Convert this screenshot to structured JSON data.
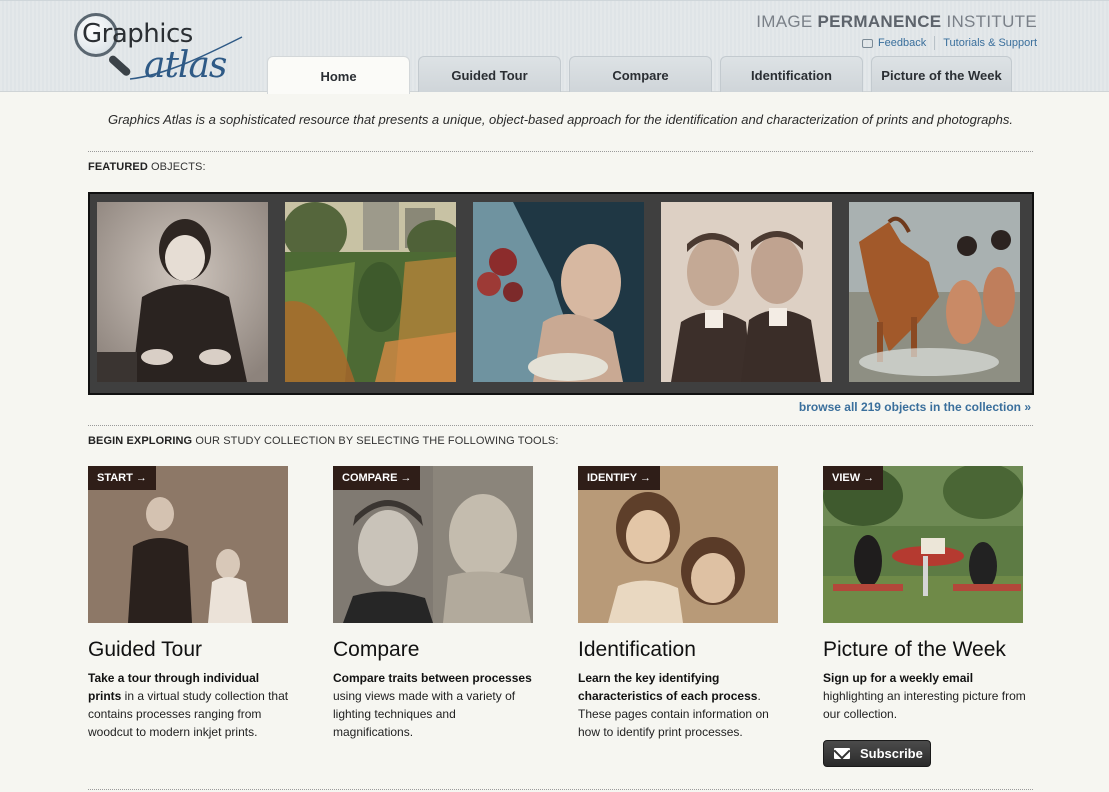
{
  "logo": {
    "word1": "Graphics",
    "word2": "atlas"
  },
  "institute": {
    "part1": "IMAGE ",
    "part2": "PERMANENCE",
    "part3": " INSTITUTE"
  },
  "util_links": {
    "feedback": "Feedback",
    "tutorials": "Tutorials & Support"
  },
  "tabs": [
    {
      "label": "Home",
      "active": true
    },
    {
      "label": "Guided Tour"
    },
    {
      "label": "Compare"
    },
    {
      "label": "Identification"
    },
    {
      "label": "Picture of the Week"
    }
  ],
  "intro": "Graphics Atlas is a sophisticated resource that presents a unique, object-based approach for the identification and characterization of prints and photographs.",
  "featured": {
    "label_bold": "FEATURED",
    "label_rest": " OBJECTS:"
  },
  "browse_link": "browse all 219 objects in the collection »",
  "explore": {
    "label_bold": "BEGIN EXPLORING",
    "label_rest": " OUR STUDY COLLECTION BY SELECTING THE FOLLOWING TOOLS:"
  },
  "tools": [
    {
      "tag": "START →",
      "title": "Guided Tour",
      "desc_bold": "Take a tour through individual prints",
      "desc_rest": " in a virtual study collection that contains processes ranging from woodcut to modern inkjet prints."
    },
    {
      "tag": "COMPARE →",
      "title": "Compare",
      "desc_bold": "Compare traits between processes",
      "desc_rest": " using views made with a variety of lighting techniques and magnifications."
    },
    {
      "tag": "IDENTIFY →",
      "title": "Identification",
      "desc_bold": "Learn the key identifying characteristics of each process",
      "desc_rest": ". These pages contain information on how to identify print processes."
    },
    {
      "tag": "VIEW →",
      "title": "Picture of the Week",
      "desc_bold": "Sign up for a weekly email",
      "desc_rest": " highlighting an interesting picture from our collection."
    }
  ],
  "subscribe_label": "Subscribe",
  "colors": {
    "link": "#3a6f9c",
    "tag_bg": "#2f1e18",
    "page_bg": "#f6f6f1"
  }
}
